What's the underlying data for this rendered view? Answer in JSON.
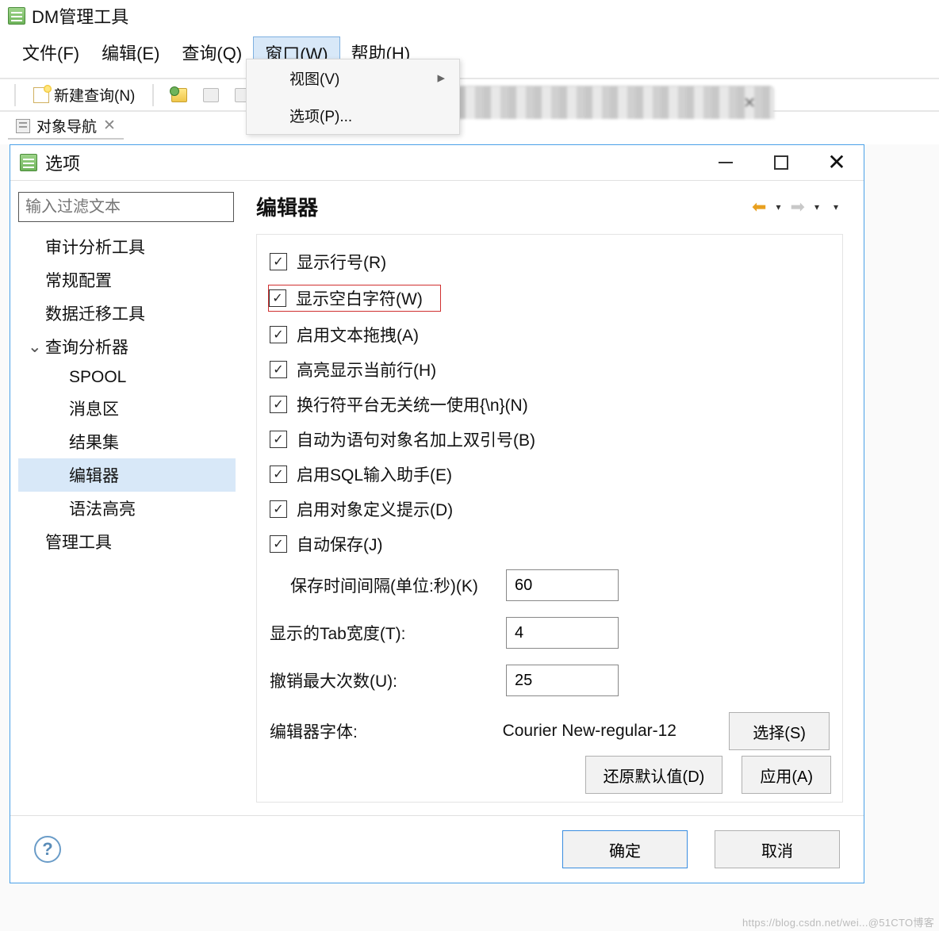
{
  "mainWindow": {
    "title": "DM管理工具",
    "menu": {
      "file": "文件(F)",
      "edit": "编辑(E)",
      "query": "查询(Q)",
      "window": "窗口(W)",
      "help": "帮助(H)"
    },
    "toolbar": {
      "newQuery": "新建查询(N)"
    },
    "tabs": {
      "objectNav": "对象导航"
    },
    "dropdown": {
      "view": "视图(V)",
      "options": "选项(P)..."
    }
  },
  "dialog": {
    "title": "选项",
    "filterPlaceholder": "输入过滤文本",
    "tree": {
      "audit": "审计分析工具",
      "general": "常规配置",
      "migrate": "数据迁移工具",
      "analyzer": "查询分析器",
      "spool": "SPOOL",
      "msg": "消息区",
      "result": "结果集",
      "editor": "编辑器",
      "syntax": "语法高亮",
      "manage": "管理工具"
    },
    "section": "编辑器",
    "checks": {
      "lineNo": "显示行号(R)",
      "whitespace": "显示空白字符(W)",
      "drag": "启用文本拖拽(A)",
      "highlight": "高亮显示当前行(H)",
      "newline": "换行符平台无关统一使用{\\n}(N)",
      "quotes": "自动为语句对象名加上双引号(B)",
      "sqlAssist": "启用SQL输入助手(E)",
      "objDef": "启用对象定义提示(D)",
      "autosave": "自动保存(J)"
    },
    "fields": {
      "intervalLabel": "保存时间间隔(单位:秒)(K)",
      "intervalValue": "60",
      "tabLabel": "显示的Tab宽度(T):",
      "tabValue": "4",
      "undoLabel": "撤销最大次数(U):",
      "undoValue": "25",
      "fontLabel": "编辑器字体:",
      "fontValue": "Courier New-regular-12",
      "selectBtn": "选择(S)"
    },
    "buttons": {
      "restore": "还原默认值(D)",
      "apply": "应用(A)",
      "ok": "确定",
      "cancel": "取消"
    }
  },
  "watermark": "https://blog.csdn.net/wei...@51CTO博客"
}
